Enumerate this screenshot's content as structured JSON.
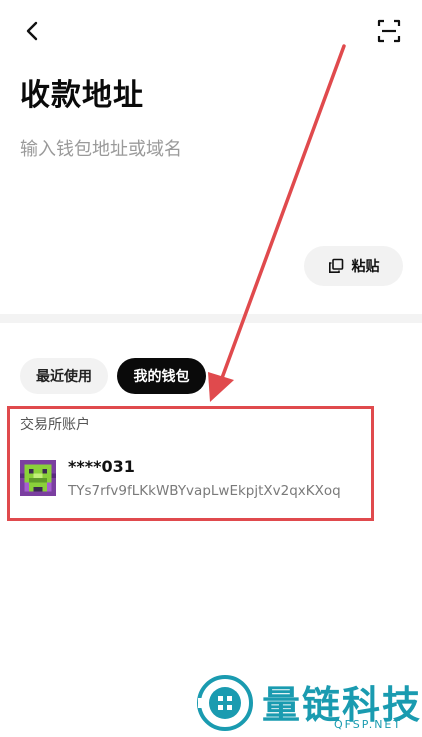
{
  "page": {
    "title": "收款地址"
  },
  "address_input": {
    "placeholder": "输入钱包地址或域名",
    "value": ""
  },
  "paste_button": {
    "label": "粘贴"
  },
  "tabs": [
    {
      "label": "最近使用",
      "active": false
    },
    {
      "label": "我的钱包",
      "active": true
    }
  ],
  "section": {
    "label": "交易所账户"
  },
  "accounts": [
    {
      "name": "****031",
      "address": "TYs7rfv9fLKkWBYvapLwEkpjtXv2qxKXoq"
    }
  ],
  "icons": {
    "back": "chevron-left-icon",
    "scan": "scan-icon",
    "paste": "copy-icon"
  },
  "annotation": {
    "color": "#e04a4d"
  },
  "watermark": {
    "text": "量链科技",
    "sub": "QFSP.NET",
    "color": "#1a9bb0"
  }
}
